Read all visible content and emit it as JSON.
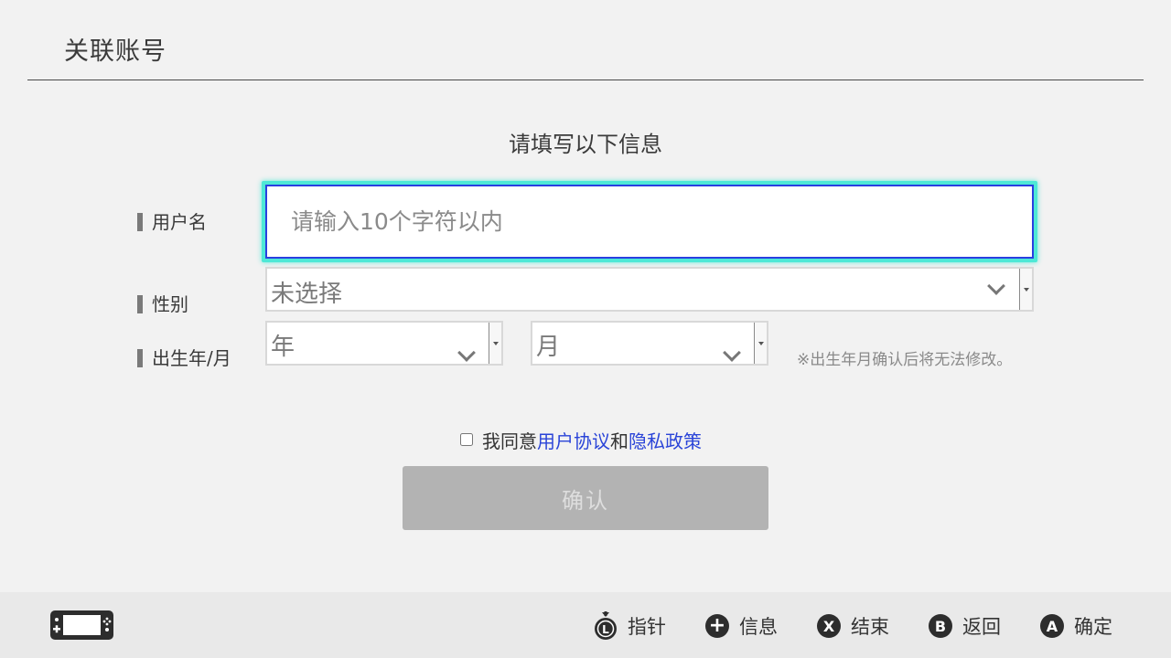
{
  "header": {
    "title": "关联账号"
  },
  "form": {
    "subtitle": "请填写以下信息",
    "username": {
      "label": "用户名",
      "placeholder": "请输入10个字符以内",
      "value": ""
    },
    "gender": {
      "label": "性别",
      "selected": "未选择"
    },
    "birth": {
      "label": "出生年/月",
      "year_selected": "年",
      "month_selected": "月",
      "note": "※出生年月确认后将无法修改。"
    },
    "agreement": {
      "prefix": "我同意",
      "user_agreement": "用户协议",
      "conjunction": "和",
      "privacy_policy": "隐私政策",
      "checked": false
    },
    "confirm_label": "确认"
  },
  "footer": {
    "hints": [
      {
        "button": "L",
        "label": "指针"
      },
      {
        "button": "+",
        "label": "信息"
      },
      {
        "button": "X",
        "label": "结束"
      },
      {
        "button": "B",
        "label": "返回"
      },
      {
        "button": "A",
        "label": "确定"
      }
    ]
  },
  "colors": {
    "background": "#f2f2f2",
    "focus_glow": "#4ee8d6",
    "focus_border": "#2a3fe0",
    "link": "#2a44d8",
    "disabled_button": "#b3b3b3"
  }
}
